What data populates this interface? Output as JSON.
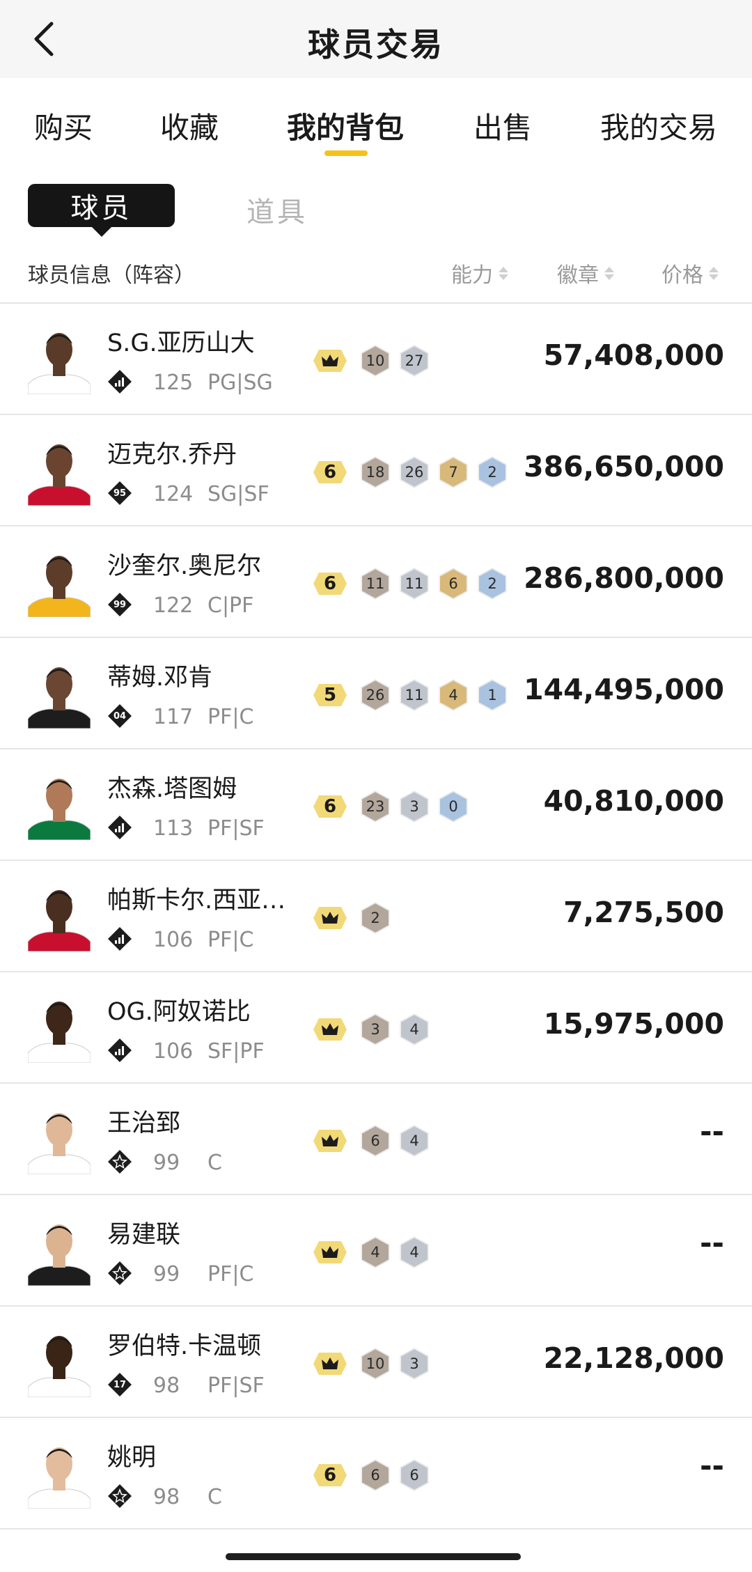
{
  "header": {
    "title": "球员交易",
    "back_icon": "chevron-left-icon"
  },
  "tabs": [
    {
      "label": "购买",
      "active": false
    },
    {
      "label": "收藏",
      "active": false
    },
    {
      "label": "我的背包",
      "active": true
    },
    {
      "label": "出售",
      "active": false
    },
    {
      "label": "我的交易",
      "active": false
    }
  ],
  "subtabs": {
    "active": "球员",
    "other": "道具"
  },
  "columns": {
    "info": "球员信息（阵容）",
    "ability": "能力",
    "badge": "徽章",
    "price": "价格"
  },
  "colors": {
    "accent": "#f5c21a",
    "ability_bg": "#f2d978",
    "bronze": "#b3a79c",
    "silver": "#c0c4cc",
    "gold": "#d8b97a",
    "blue": "#a9c2df"
  },
  "players": [
    {
      "name": "S.G.亚历山大",
      "card": "bars",
      "rating": "125",
      "position": "PG|SG",
      "ability": "crown",
      "badges": [
        {
          "value": "10",
          "tier": "bronze"
        },
        {
          "value": "27",
          "tier": "silver"
        }
      ],
      "price": "57,408,000"
    },
    {
      "name": "迈克尔.乔丹",
      "card": "95",
      "rating": "124",
      "position": "SG|SF",
      "ability": "6",
      "badges": [
        {
          "value": "18",
          "tier": "bronze"
        },
        {
          "value": "26",
          "tier": "silver"
        },
        {
          "value": "7",
          "tier": "gold"
        },
        {
          "value": "2",
          "tier": "blue"
        }
      ],
      "price": "386,650,000"
    },
    {
      "name": "沙奎尔.奥尼尔",
      "card": "99",
      "rating": "122",
      "position": "C|PF",
      "ability": "6",
      "badges": [
        {
          "value": "11",
          "tier": "bronze"
        },
        {
          "value": "11",
          "tier": "silver"
        },
        {
          "value": "6",
          "tier": "gold"
        },
        {
          "value": "2",
          "tier": "blue"
        }
      ],
      "price": "286,800,000"
    },
    {
      "name": "蒂姆.邓肯",
      "card": "04",
      "rating": "117",
      "position": "PF|C",
      "ability": "5",
      "badges": [
        {
          "value": "26",
          "tier": "bronze"
        },
        {
          "value": "11",
          "tier": "silver"
        },
        {
          "value": "4",
          "tier": "gold"
        },
        {
          "value": "1",
          "tier": "blue"
        }
      ],
      "price": "144,495,000"
    },
    {
      "name": "杰森.塔图姆",
      "card": "bars",
      "rating": "113",
      "position": "PF|SF",
      "ability": "6",
      "badges": [
        {
          "value": "23",
          "tier": "bronze"
        },
        {
          "value": "3",
          "tier": "silver"
        },
        {
          "value": "0",
          "tier": "blue"
        }
      ],
      "price": "40,810,000"
    },
    {
      "name": "帕斯卡尔.西亚…",
      "card": "bars",
      "rating": "106",
      "position": "PF|C",
      "ability": "crown",
      "badges": [
        {
          "value": "2",
          "tier": "bronze"
        }
      ],
      "price": "7,275,500"
    },
    {
      "name": "OG.阿奴诺比",
      "card": "bars",
      "rating": "106",
      "position": "SF|PF",
      "ability": "crown",
      "badges": [
        {
          "value": "3",
          "tier": "bronze"
        },
        {
          "value": "4",
          "tier": "silver"
        }
      ],
      "price": "15,975,000"
    },
    {
      "name": "王治郅",
      "card": "star",
      "rating": "99",
      "position": "C",
      "ability": "crown",
      "badges": [
        {
          "value": "6",
          "tier": "bronze"
        },
        {
          "value": "4",
          "tier": "silver"
        }
      ],
      "price": "--"
    },
    {
      "name": "易建联",
      "card": "star",
      "rating": "99",
      "position": "PF|C",
      "ability": "crown",
      "badges": [
        {
          "value": "4",
          "tier": "bronze"
        },
        {
          "value": "4",
          "tier": "silver"
        }
      ],
      "price": "--"
    },
    {
      "name": "罗伯特.卡温顿",
      "card": "17",
      "rating": "98",
      "position": "PF|SF",
      "ability": "crown",
      "badges": [
        {
          "value": "10",
          "tier": "bronze"
        },
        {
          "value": "3",
          "tier": "silver"
        }
      ],
      "price": "22,128,000"
    },
    {
      "name": "姚明",
      "card": "star",
      "rating": "98",
      "position": "C",
      "ability": "6",
      "badges": [
        {
          "value": "6",
          "tier": "bronze"
        },
        {
          "value": "6",
          "tier": "silver"
        }
      ],
      "price": "--"
    }
  ]
}
